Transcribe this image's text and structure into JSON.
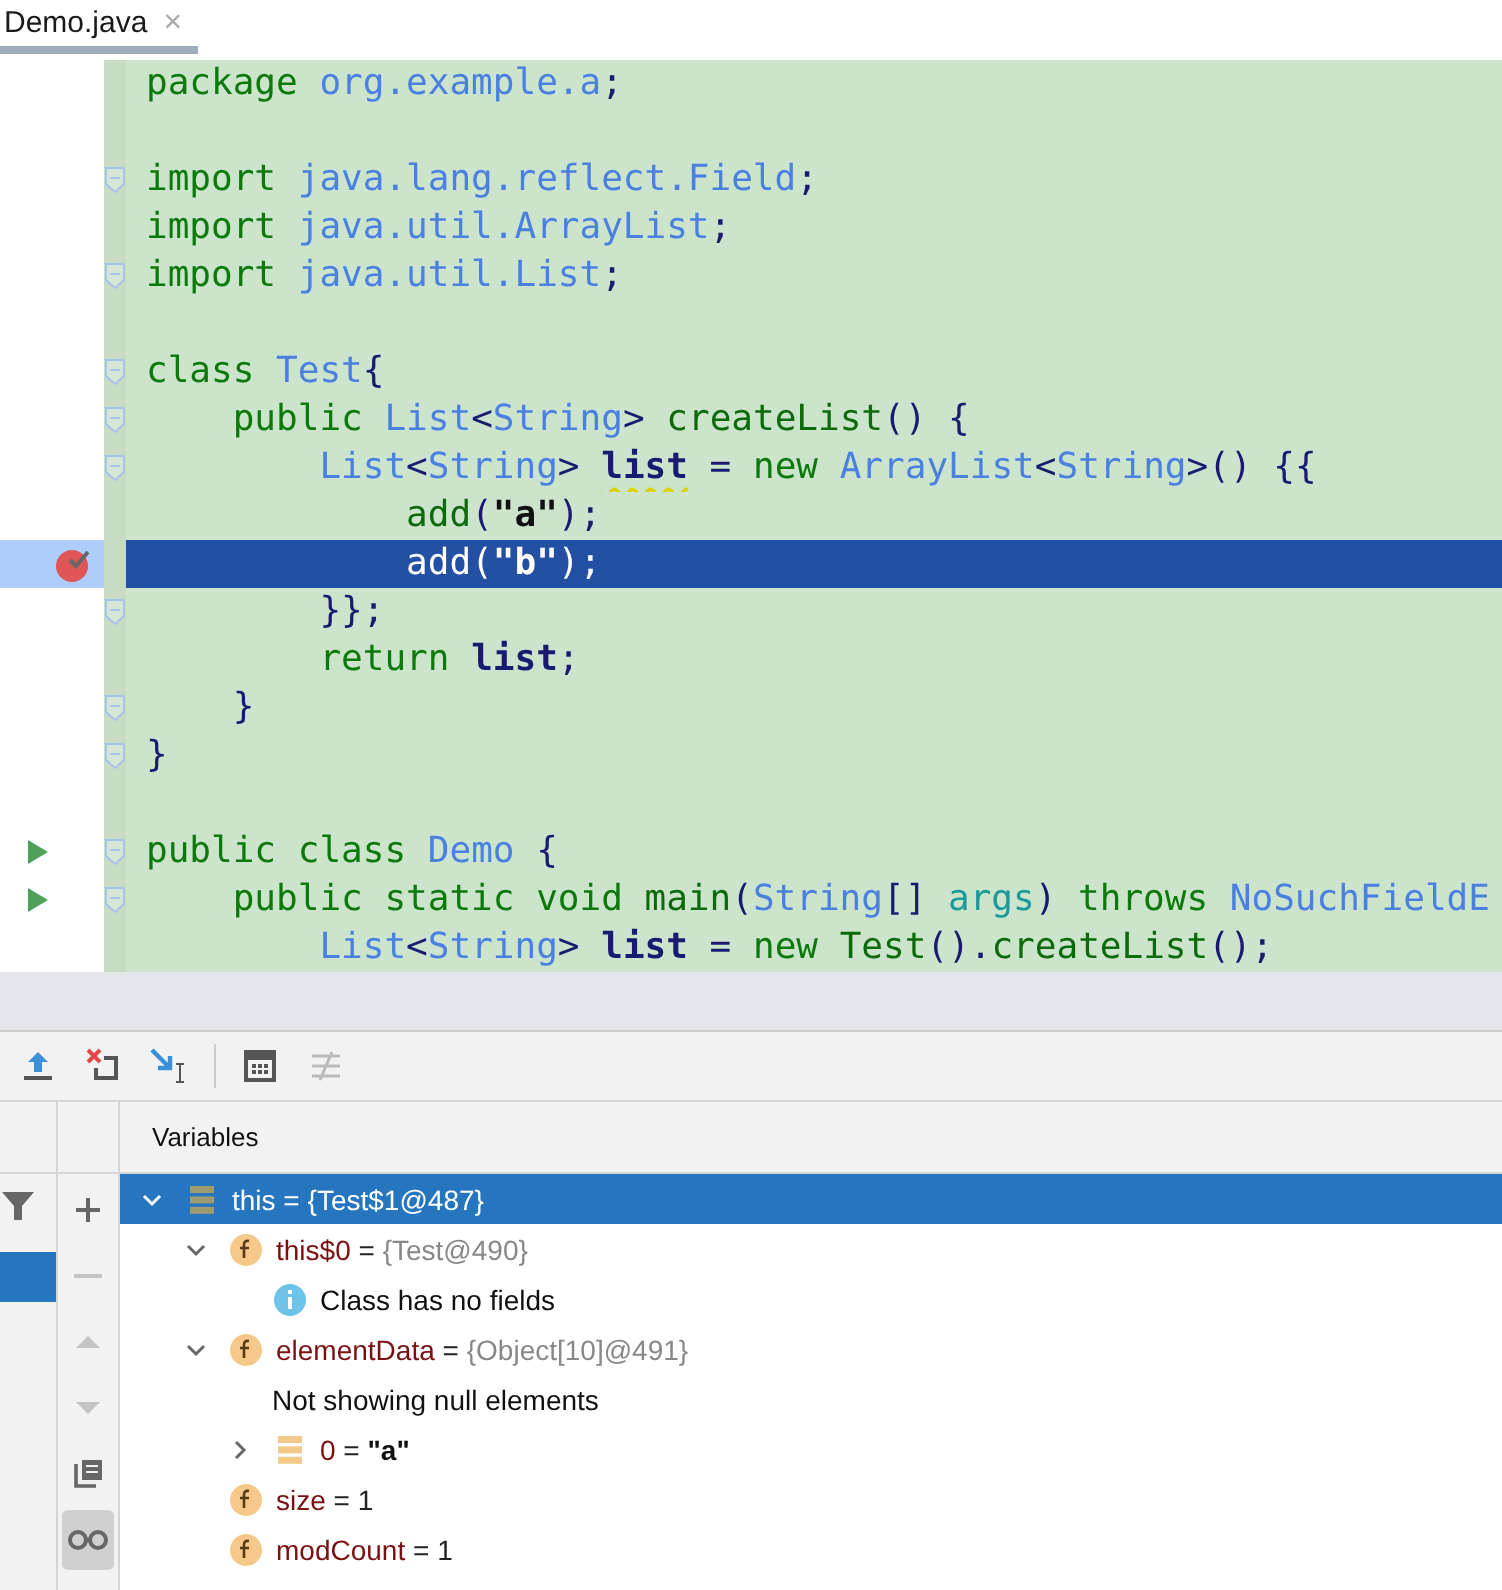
{
  "tab": {
    "title": "Demo.java",
    "close": "×",
    "selected": true
  },
  "code_lines": [
    {
      "kind": "code",
      "tokens": [
        {
          "kind": "kw",
          "text": "package "
        },
        {
          "kind": "type",
          "text": "org.example.a"
        },
        {
          "kind": "punct",
          "text": ";"
        }
      ]
    },
    {
      "kind": "blank"
    },
    {
      "fold": true,
      "tokens": [
        {
          "kind": "kw",
          "text": "import "
        },
        {
          "kind": "type",
          "text": "java.lang.reflect.Field"
        },
        {
          "kind": "punct",
          "text": ";"
        }
      ]
    },
    {
      "tokens": [
        {
          "kind": "kw",
          "text": "import "
        },
        {
          "kind": "type",
          "text": "java.util.ArrayList"
        },
        {
          "kind": "punct",
          "text": ";"
        }
      ]
    },
    {
      "fold": true,
      "tokens": [
        {
          "kind": "kw",
          "text": "import "
        },
        {
          "kind": "type",
          "text": "java.util.List"
        },
        {
          "kind": "punct",
          "text": ";"
        }
      ]
    },
    {
      "kind": "blank"
    },
    {
      "fold": true,
      "tokens": [
        {
          "kind": "kw",
          "text": "class "
        },
        {
          "kind": "type",
          "text": "Test"
        },
        {
          "kind": "punct",
          "text": "{"
        }
      ]
    },
    {
      "fold": true,
      "tokens": [
        {
          "kind": "kw",
          "text": "    public "
        },
        {
          "kind": "type",
          "text": "List"
        },
        {
          "kind": "punct",
          "text": "<"
        },
        {
          "kind": "type",
          "text": "String"
        },
        {
          "kind": "punct",
          "text": "> "
        },
        {
          "kind": "fn",
          "text": "createList"
        },
        {
          "kind": "punct",
          "text": "() {"
        }
      ]
    },
    {
      "fold": true,
      "tokens": [
        {
          "kind": "type",
          "text": "        List"
        },
        {
          "kind": "punct",
          "text": "<"
        },
        {
          "kind": "type",
          "text": "String"
        },
        {
          "kind": "punct",
          "text": "> "
        },
        {
          "kind": "var",
          "text": "list",
          "warn": true
        },
        {
          "kind": "punct",
          "text": " = "
        },
        {
          "kind": "kw",
          "text": "new "
        },
        {
          "kind": "type",
          "text": "ArrayList"
        },
        {
          "kind": "punct",
          "text": "<"
        },
        {
          "kind": "type",
          "text": "String"
        },
        {
          "kind": "punct",
          "text": ">() {{"
        }
      ]
    },
    {
      "tokens": [
        {
          "kind": "fn",
          "text": "            add"
        },
        {
          "kind": "punct",
          "text": "("
        },
        {
          "kind": "str",
          "text": "\"a\""
        },
        {
          "kind": "punct",
          "text": ");"
        }
      ]
    },
    {
      "breakpoint": true,
      "current": true,
      "tokens": [
        {
          "kind": "fn",
          "text": "            add"
        },
        {
          "kind": "punct",
          "text": "("
        },
        {
          "kind": "str",
          "text": "\"b\""
        },
        {
          "kind": "punct",
          "text": ");"
        }
      ]
    },
    {
      "fold": true,
      "tokens": [
        {
          "kind": "punct",
          "text": "        }};"
        }
      ]
    },
    {
      "tokens": [
        {
          "kind": "kw",
          "text": "        return "
        },
        {
          "kind": "var",
          "text": "list"
        },
        {
          "kind": "punct",
          "text": ";"
        }
      ]
    },
    {
      "fold": true,
      "tokens": [
        {
          "kind": "punct",
          "text": "    }"
        }
      ]
    },
    {
      "fold": true,
      "tokens": [
        {
          "kind": "punct",
          "text": "}"
        }
      ]
    },
    {
      "kind": "blank"
    },
    {
      "run": true,
      "fold": true,
      "tokens": [
        {
          "kind": "kw",
          "text": "public class "
        },
        {
          "kind": "type",
          "text": "Demo"
        },
        {
          "kind": "punct",
          "text": " {"
        }
      ]
    },
    {
      "run": true,
      "fold": true,
      "tokens": [
        {
          "kind": "kw",
          "text": "    public static void "
        },
        {
          "kind": "fn",
          "text": "main"
        },
        {
          "kind": "punct",
          "text": "("
        },
        {
          "kind": "type",
          "text": "String"
        },
        {
          "kind": "punct",
          "text": "[] "
        },
        {
          "kind": "param",
          "text": "args"
        },
        {
          "kind": "punct",
          "text": ") "
        },
        {
          "kind": "kw",
          "text": "throws "
        },
        {
          "kind": "type",
          "text": "NoSuchFieldE"
        }
      ]
    },
    {
      "tokens": [
        {
          "kind": "type",
          "text": "        List"
        },
        {
          "kind": "punct",
          "text": "<"
        },
        {
          "kind": "type",
          "text": "String"
        },
        {
          "kind": "punct",
          "text": "> "
        },
        {
          "kind": "var",
          "text": "list"
        },
        {
          "kind": "punct",
          "text": " = "
        },
        {
          "kind": "kw",
          "text": "new "
        },
        {
          "kind": "fn",
          "text": "Test"
        },
        {
          "kind": "punct",
          "text": "()."
        },
        {
          "kind": "fn",
          "text": "createList"
        },
        {
          "kind": "punct",
          "text": "();"
        }
      ]
    }
  ],
  "toolbar_buttons": [
    {
      "disabled": false
    },
    {
      "disabled": false
    },
    {
      "disabled": false
    },
    {
      "disabled": false
    },
    {
      "disabled": true
    }
  ],
  "side_buttons": [
    {
      "disabled": false,
      "on": false
    },
    {
      "disabled": true,
      "on": false
    },
    {
      "disabled": true,
      "on": false
    },
    {
      "disabled": true,
      "on": false
    },
    {
      "disabled": false,
      "on": false
    },
    {
      "disabled": false,
      "on": true
    }
  ],
  "variables": {
    "title": "Variables",
    "tree": [
      {
        "kind": "object",
        "name": "this",
        "eq": " = ",
        "value": {
          "kind": "ref",
          "text": "{Test$1@487}"
        },
        "expanded": true,
        "selected": true,
        "children": [
          {
            "kind": "field",
            "name": "this$0",
            "eq": " = ",
            "value": {
              "kind": "ref",
              "text": "{Test@490}"
            },
            "expanded": true,
            "selected": false,
            "children": [
              {
                "kind": "info",
                "name": "Class has no fields",
                "selected": false
              }
            ]
          },
          {
            "kind": "field",
            "name": "elementData",
            "eq": " = ",
            "value": {
              "kind": "ref",
              "text": "{Object[10]@491}"
            },
            "expanded": true,
            "selected": false,
            "children": [
              {
                "kind": "message",
                "name": "Not showing null elements",
                "selected": false
              },
              {
                "kind": "array",
                "name": "0",
                "eq": " = ",
                "value": {
                  "kind": "string",
                  "text": "\"a\""
                },
                "expanded": false,
                "selected": false
              }
            ]
          },
          {
            "kind": "field",
            "name": "size",
            "eq": " = ",
            "value": {
              "kind": "plain",
              "text": "1"
            },
            "selected": false
          },
          {
            "kind": "field",
            "name": "modCount",
            "eq": " = ",
            "value": {
              "kind": "plain",
              "text": "1"
            },
            "selected": false
          }
        ]
      }
    ]
  }
}
